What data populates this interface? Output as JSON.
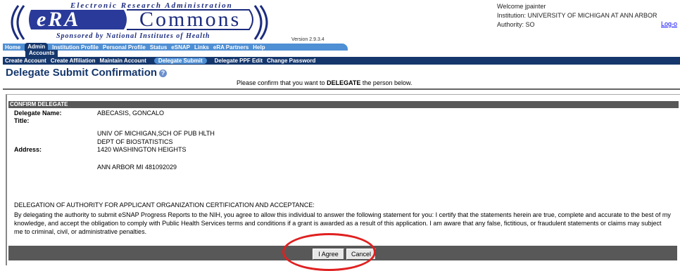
{
  "header": {
    "era_title": "Electronic Research Administration",
    "era": "eRA",
    "commons": "Commons",
    "sponsor": "Sponsored by National Institutes of Health",
    "version": "Version 2.9.3.4",
    "welcome": "Welcome jpainter",
    "institution": "Institution: UNIVERSITY OF MICHIGAN AT ANN ARBOR",
    "authority": "Authority:  SO",
    "logout": "Log-o"
  },
  "nav": {
    "tabs": [
      "Home",
      "Admin",
      "Institution Profile",
      "Personal Profile",
      "Status",
      "eSNAP",
      "Links",
      "eRA Partners",
      "Help"
    ],
    "admin_sub": "Accounts",
    "subtabs": [
      "Create Account",
      "Create Affiliation",
      "Maintain Account",
      "Delegate Submit",
      "Delegate PPF Edit",
      "Change Password"
    ]
  },
  "page": {
    "title": "Delegate Submit Confirmation",
    "instruction_pre": "Please confirm that you want to ",
    "instruction_bold": "DELEGATE",
    "instruction_post": " the person below."
  },
  "confirm": {
    "section_title": "CONFIRM DELEGATE",
    "name_label": "Delegate Name:",
    "name_value": "ABECASIS, GONCALO",
    "title_label": "Title:",
    "address_label": "Address:",
    "address_lines": [
      "UNIV OF MICHIGAN,SCH OF PUB HLTH",
      "DEPT OF BIOSTATISTICS",
      "1420 WASHINGTON HEIGHTS",
      "ANN ARBOR  MI 481092029"
    ]
  },
  "delegation": {
    "heading": "DELEGATION OF AUTHORITY FOR APPLICANT ORGANIZATION CERTIFICATION AND ACCEPTANCE:",
    "statement": "By delegating the authority to submit eSNAP Progress Reports to the NIH, you agree to allow this individual to answer the following statement for you: I certify that the statements herein are true, complete and accurate to the best of my knowledge, and accept the obligation to comply with Public Health Services terms and conditions if a grant is awarded as a result of this application. I am aware that any false, fictitious, or fraudulent statements or claims may subject me to criminal, civil, or administrative penalties."
  },
  "buttons": {
    "agree": "I Agree",
    "cancel": "Cancel"
  },
  "colors": {
    "nav_light": "#4f8fd4",
    "nav_dark": "#15376c",
    "section_bar": "#585858",
    "highlight_circle": "#e02020"
  }
}
